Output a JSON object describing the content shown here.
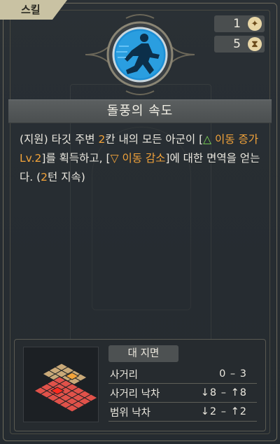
{
  "tab": {
    "label": "스킬"
  },
  "counters": [
    {
      "value": "1",
      "icon": "star-coin-icon"
    },
    {
      "value": "5",
      "icon": "hourglass-icon"
    }
  ],
  "skill": {
    "name": "돌풍의 속도",
    "icon": "running-figure-icon",
    "desc": {
      "p1": "(지원) 타깃 주변 ",
      "range": "2",
      "p2": "칸 내의 모든 아군이 [",
      "buff_symbol": "△",
      "buff_name": "이동 증가Lv.2",
      "p3": "]를 획득하고, [",
      "debuff_symbol": "▽",
      "debuff_name": "이동 감소",
      "p4": "]에 대한 면역을 얻는다. (",
      "duration": "2",
      "p5": "턴 지속)"
    },
    "colors": {
      "highlight": "#f2a33a",
      "buff": "#7ed957"
    }
  },
  "target_info": {
    "header": "대 지면",
    "rows": [
      {
        "label": "사거리",
        "value": "0 – 3"
      },
      {
        "label": "사거리 낙차",
        "value": "↓8 – ↑8"
      },
      {
        "label": "범위 낙차",
        "value": "↓2 – ↑2"
      }
    ]
  }
}
